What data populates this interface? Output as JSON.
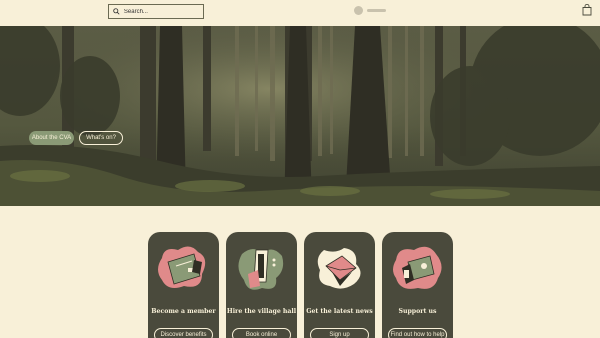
{
  "header": {
    "search": {
      "placeholder": "Search..."
    },
    "icons": {
      "search": "search-icon",
      "cart": "shopping-bag-icon",
      "avatar": "user-avatar-icon"
    }
  },
  "hero": {
    "buttons": {
      "about": "About the CVA",
      "whats_on": "What's on?"
    }
  },
  "cards": [
    {
      "title": "Become a member",
      "button": "Discover benefits",
      "icon": "membership-card-icon"
    },
    {
      "title": "Hire the village hall",
      "button": "Book online",
      "icon": "phone-booking-icon"
    },
    {
      "title": "Get the latest news",
      "button": "Sign up",
      "icon": "envelope-icon"
    },
    {
      "title": "Support us",
      "button": "Find out how to help",
      "icon": "donation-phone-icon"
    }
  ],
  "colors": {
    "background": "#f8f0d8",
    "card": "#4a4a3c",
    "accent_green": "#8a9a76",
    "accent_pink": "#e08a8a"
  }
}
